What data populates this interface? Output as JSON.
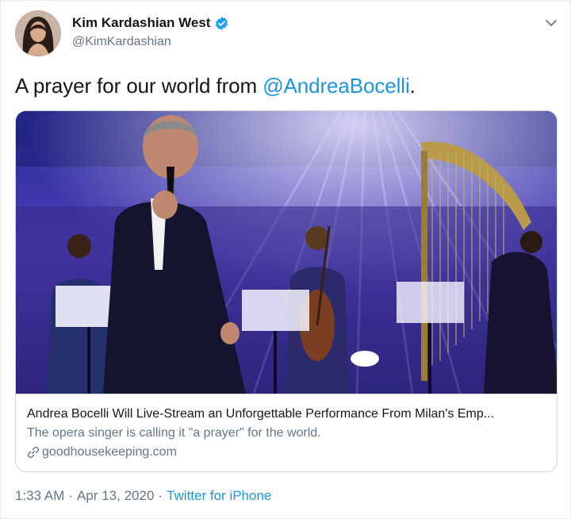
{
  "tweet": {
    "author_name": "Kim Kardashian West",
    "author_handle": "@KimKardashian",
    "text_prefix": "A prayer for our world from ",
    "mention": "@AndreaBocelli",
    "text_suffix": ".",
    "verified_icon": "verified-badge-icon",
    "menu_icon": "chevron-down-icon"
  },
  "card": {
    "image_icon": "concert-photo",
    "title": "Andrea Bocelli Will Live-Stream an Unforgettable Performance From Milan's Emp...",
    "description": "The opera singer is calling it \"a prayer\" for the world.",
    "domain": "goodhousekeeping.com",
    "domain_icon": "link-icon"
  },
  "meta": {
    "time": "1:33 AM",
    "separator1": "·",
    "date": "Apr 13, 2020",
    "separator2": "·",
    "source": "Twitter for iPhone"
  },
  "colors": {
    "link": "#1b95e0",
    "secondary": "#657786",
    "border": "#ccd6dd"
  }
}
